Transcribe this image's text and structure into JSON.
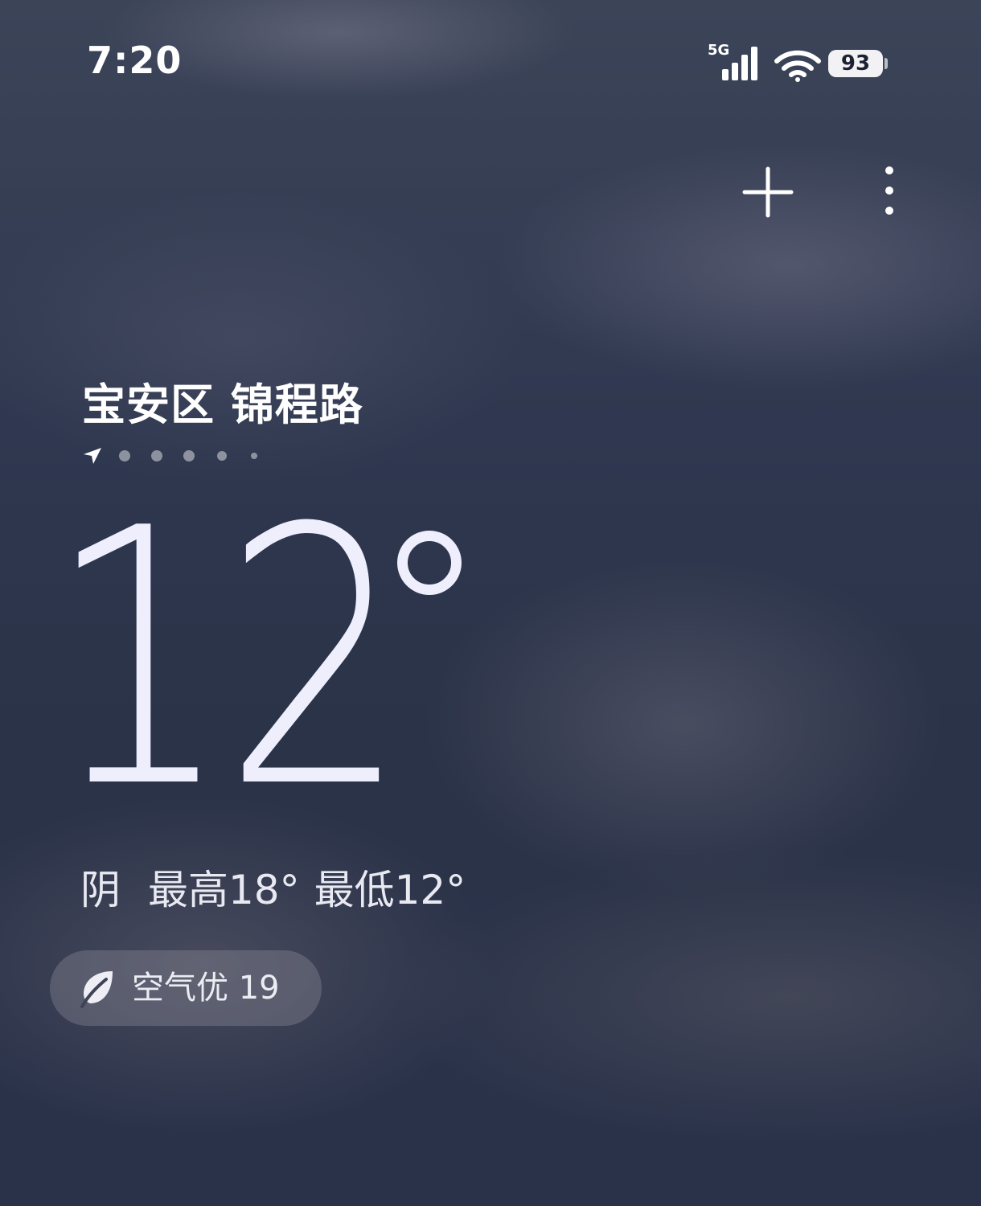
{
  "status_bar": {
    "time": "7:20",
    "network": "5G",
    "battery": "93"
  },
  "location": {
    "name": "宝安区 锦程路",
    "page_count": 6,
    "current_page": 1
  },
  "weather": {
    "temperature": "12",
    "condition": "阴",
    "high": "最高18°",
    "low": "最低12°"
  },
  "air_quality": {
    "label": "空气优 19"
  },
  "icons": {
    "add": "plus-icon",
    "more": "more-vertical-icon",
    "location": "location-arrow-icon",
    "air": "leaf-icon",
    "signal": "cellular-signal-icon",
    "wifi": "wifi-icon"
  }
}
